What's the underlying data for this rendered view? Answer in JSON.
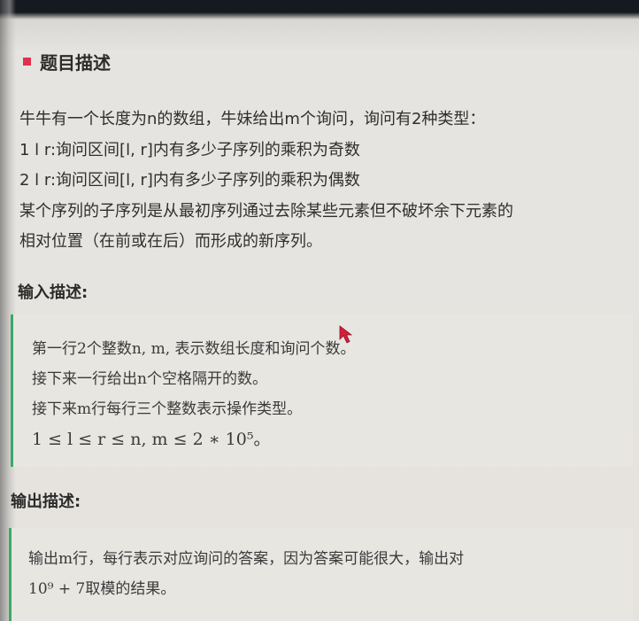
{
  "problem": {
    "title": "题目描述",
    "desc_lines": [
      "牛牛有一个长度为n的数组，牛妹给出m个询问，询问有2种类型：",
      "1 l r:询问区间[l, r]内有多少子序列的乘积为奇数",
      "2 l r:询问区间[l, r]内有多少子序列的乘积为偶数",
      "某个序列的子序列是从最初序列通过去除某些元素但不破坏余下元素的",
      "相对位置（在前或在后）而形成的新序列。"
    ]
  },
  "input": {
    "label": "输入描述:",
    "lines": [
      "第一行2个整数n, m, 表示数组长度和询问个数。",
      "接下来一行给出n个空格隔开的数。",
      "接下来m行每行三个整数表示操作类型。",
      "1 ≤ l ≤ r ≤ n, m ≤ 2 ∗ 10⁵。"
    ]
  },
  "output": {
    "label": "输出描述:",
    "lines": [
      "输出m行，每行表示对应询问的答案，因为答案可能很大，输出对",
      "10⁹ + 7取模的结果。"
    ]
  },
  "colors": {
    "title_marker": "#e0304e",
    "quote_border": "#3aa86a",
    "cursor": "#d4203c"
  },
  "icons": {
    "title_marker": "red-square-icon",
    "cursor": "mouse-pointer-icon"
  }
}
